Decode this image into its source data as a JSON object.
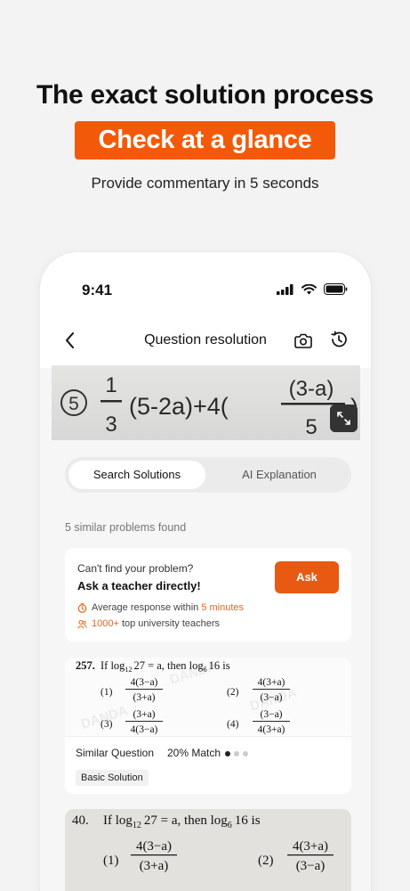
{
  "hero": {
    "title": "The exact solution process",
    "badge": "Check at a glance",
    "subtitle": "Provide commentary in 5 seconds",
    "badge_color": "#f25a0a"
  },
  "status_bar": {
    "time": "9:41"
  },
  "nav": {
    "title": "Question resolution",
    "icons": [
      "back-arrow-icon",
      "camera-icon",
      "history-icon"
    ]
  },
  "photo": {
    "number": "5",
    "frac1_num": "1",
    "frac1_den": "3",
    "paren": "(5-2a)+4(",
    "frac2_num": "(3-a)",
    "frac2_den": "5"
  },
  "tabs": {
    "active": "Search Solutions",
    "inactive": "AI Explanation"
  },
  "results": {
    "found_text": "5 similar problems found"
  },
  "ask_card": {
    "question": "Can't find your problem?",
    "headline": "Ask a teacher directly!",
    "button": "Ask",
    "line1_prefix": "Average response within ",
    "line1_highlight": "5 minutes",
    "line2_highlight": "1000+",
    "line2_suffix": " top university teachers",
    "accent": "#e85912"
  },
  "similar_card": {
    "problem_number": "257.",
    "problem_text": "If log",
    "log_base_1": "12",
    "problem_mid": "27 = a, then log",
    "log_base_2": "6",
    "problem_end": "16 is",
    "options": [
      {
        "label": "(1)",
        "num": "4(3−a)",
        "den": "(3+a)"
      },
      {
        "label": "(2)",
        "num": "4(3+a)",
        "den": "(3−a)"
      },
      {
        "label": "(3)",
        "num": "(3+a)",
        "den": "4(3−a)"
      },
      {
        "label": "(4)",
        "num": "(3−a)",
        "den": "4(3+a)"
      }
    ],
    "label": "Similar Question",
    "match": "20% Match",
    "tag": "Basic Solution"
  },
  "second_card": {
    "problem_number": "40.",
    "problem_text": "If log",
    "log_base_1": "12",
    "problem_mid": "27 = a, then log",
    "log_base_2": "6",
    "problem_end": "16 is",
    "options": [
      {
        "label": "(1)",
        "num": "4(3−a)",
        "den": "(3+a)"
      },
      {
        "label": "(2)",
        "num": "4(3+a)",
        "den": "(3−a)"
      }
    ]
  }
}
